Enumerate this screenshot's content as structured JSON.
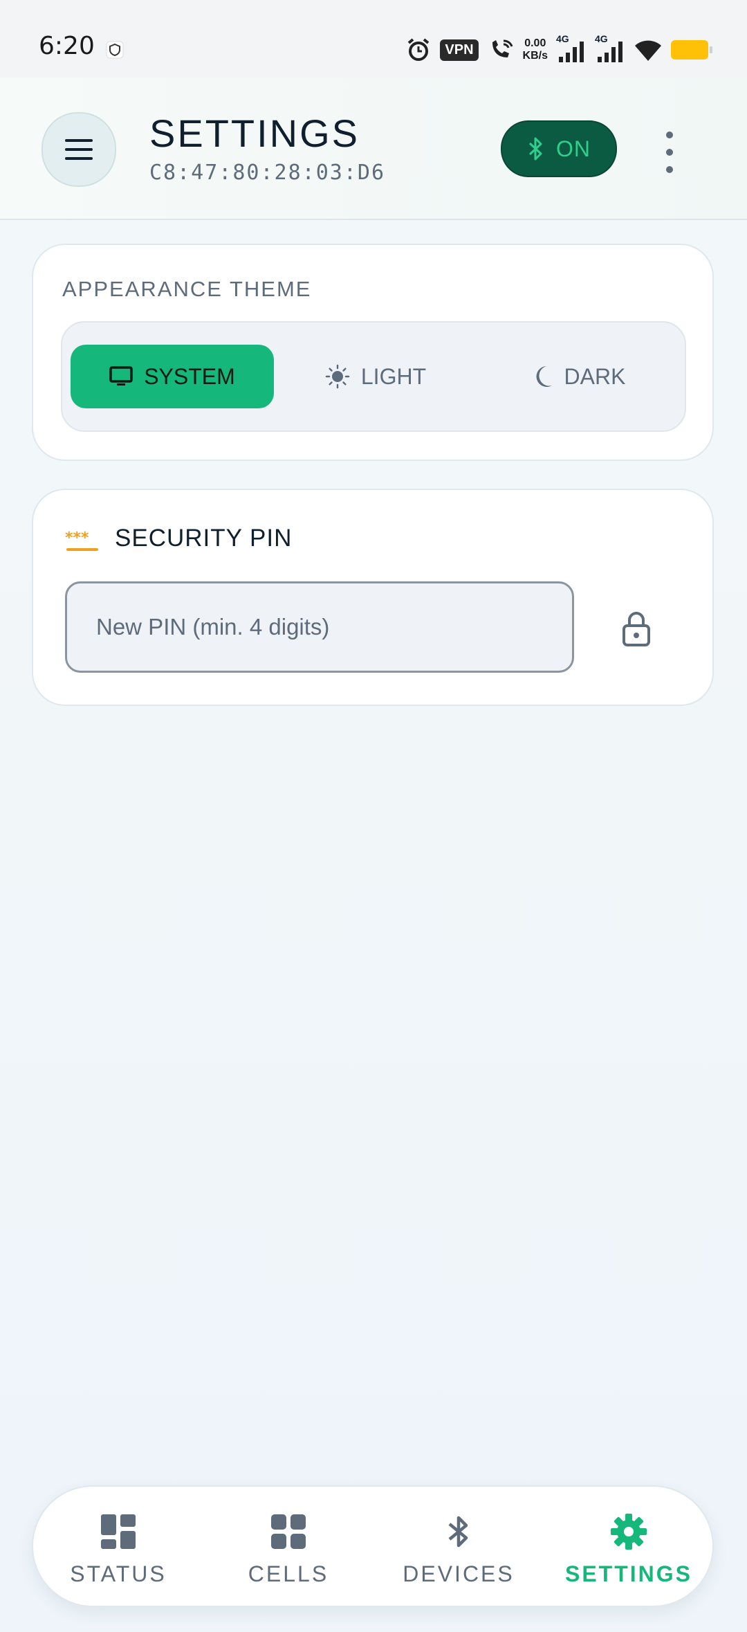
{
  "status_bar": {
    "time": "6:20",
    "vpn_label": "VPN",
    "speed_value": "0.00",
    "speed_unit": "KB/s",
    "network_1": "4G",
    "network_2": "4G",
    "battery_color": "#ffc107"
  },
  "header": {
    "title": "SETTINGS",
    "device_address": "C8:47:80:28:03:D6",
    "bluetooth_status": "ON"
  },
  "appearance": {
    "section_label": "APPEARANCE THEME",
    "options": [
      {
        "label": "SYSTEM",
        "icon": "monitor-icon",
        "selected": true
      },
      {
        "label": "LIGHT",
        "icon": "sun-icon",
        "selected": false
      },
      {
        "label": "DARK",
        "icon": "moon-icon",
        "selected": false
      }
    ]
  },
  "security": {
    "title": "SECURITY PIN",
    "icon": "asterisk-password-icon",
    "pin_placeholder": "New PIN (min. 4 digits)",
    "pin_value": "",
    "lock_icon": "lock-icon"
  },
  "bottom_nav": {
    "items": [
      {
        "label": "STATUS",
        "icon": "dashboard-icon",
        "active": false
      },
      {
        "label": "CELLS",
        "icon": "grid-icon",
        "active": false
      },
      {
        "label": "DEVICES",
        "icon": "bluetooth-icon",
        "active": false
      },
      {
        "label": "SETTINGS",
        "icon": "gear-icon",
        "active": true
      }
    ]
  },
  "colors": {
    "accent": "#16b77a",
    "bt_pill_bg": "#0b5a42",
    "muted_text": "#5d6b7a",
    "pin_icon": "#f0a020"
  }
}
